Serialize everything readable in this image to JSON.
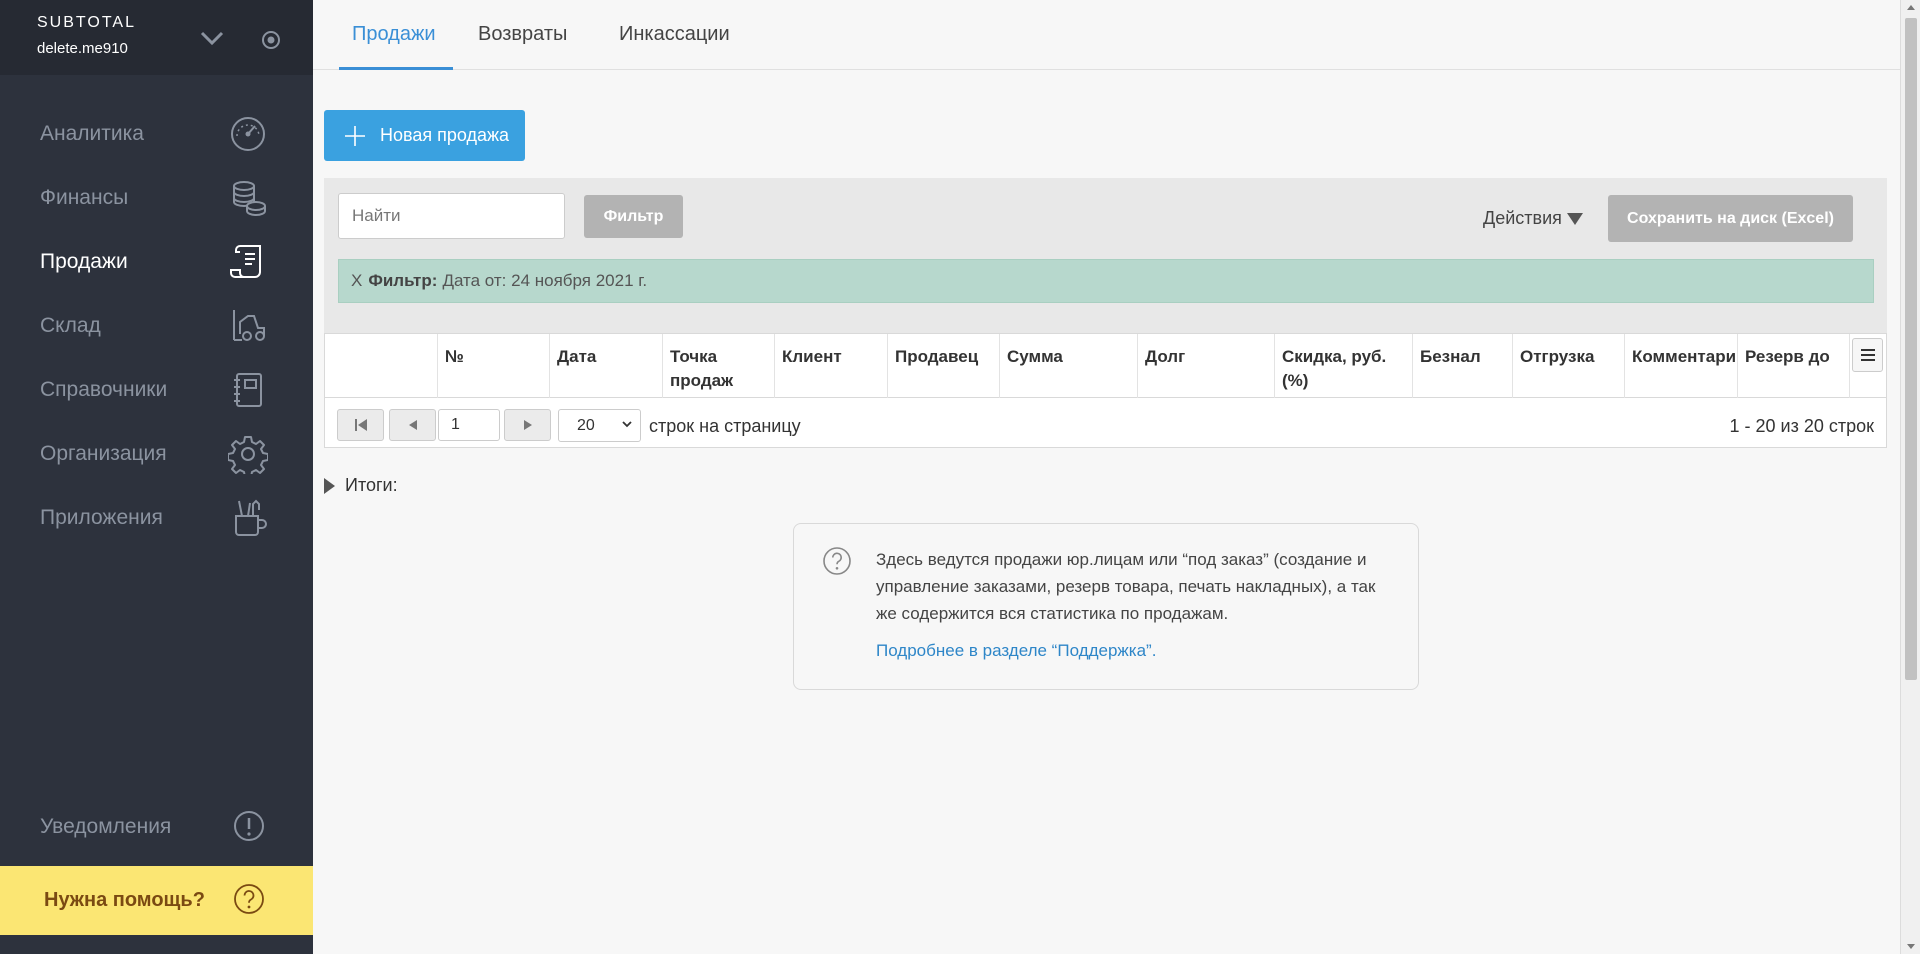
{
  "brand": {
    "name": "SUBTOTAL",
    "user": "delete.me910"
  },
  "sidebar": {
    "items": [
      {
        "label": "Аналитика",
        "icon": "gauge-icon"
      },
      {
        "label": "Финансы",
        "icon": "coins-icon"
      },
      {
        "label": "Продажи",
        "icon": "receipt-icon",
        "active": true
      },
      {
        "label": "Склад",
        "icon": "forklift-icon"
      },
      {
        "label": "Справочники",
        "icon": "notebook-icon"
      },
      {
        "label": "Организация",
        "icon": "gear-icon"
      },
      {
        "label": "Приложения",
        "icon": "tools-cup-icon"
      }
    ],
    "notifications": "Уведомления",
    "help": "Нужна помощь?"
  },
  "tabs": [
    {
      "label": "Продажи",
      "active": true
    },
    {
      "label": "Возвраты"
    },
    {
      "label": "Инкассации"
    }
  ],
  "toolbar": {
    "new_sale": "Новая продажа",
    "search_placeholder": "Найти",
    "filter": "Фильтр",
    "actions": "Действия",
    "save_excel": "Сохранить на диск (Excel)",
    "filter_close": "X",
    "filter_label": "Фильтр:",
    "filter_value": "Дата от: 24 ноября 2021 г."
  },
  "table": {
    "columns": [
      "№",
      "Дата",
      "Точка продаж",
      "Клиент",
      "Продавец",
      "Сумма",
      "Долг",
      "Скидка, руб. (%)",
      "Безнал",
      "Отгрузка",
      "Комментарий",
      "Резерв до"
    ]
  },
  "pager": {
    "page": "1",
    "per_page": "20",
    "per_page_label": "строк на страницу",
    "count": "1 - 20 из 20 строк"
  },
  "totals": "Итоги:",
  "info": {
    "text": "Здесь ведутся продажи юр.лицам или “под заказ” (создание и управление заказами, резерв товара, печать накладных), а так же содержится вся статистика по продажам.",
    "link": "Подробнее в разделе “Поддержка”."
  },
  "colors": {
    "sidebar": "#2d323d",
    "accent": "#3aa1e0",
    "help": "#fbe673",
    "filter_bar": "#b7d8cd"
  }
}
